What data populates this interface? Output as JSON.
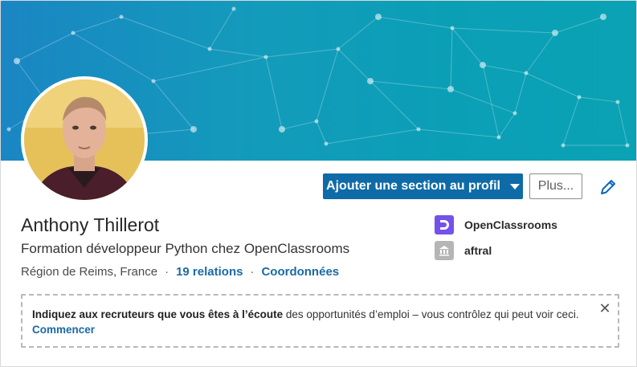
{
  "profile": {
    "name": "Anthony Thillerot",
    "headline": "Formation développeur Python chez OpenClassrooms",
    "location": "Région de Reims, France",
    "separator": "·",
    "relations_link": "19 relations",
    "contact_link": "Coordonnées"
  },
  "actions": {
    "add_section_label": "Ajouter une section au profil",
    "more_label": "Plus...",
    "edit_icon": "pencil-icon"
  },
  "organizations": [
    {
      "name": "OpenClassrooms",
      "logo": "openclassrooms-logo",
      "color": "#7451eb"
    },
    {
      "name": "aftral",
      "logo": "building-icon",
      "color": "#b5b5b5"
    }
  ],
  "notice": {
    "bold_text": "Indiquez aux recruteurs que vous êtes à l’écoute",
    "text": " des opportunités d’emploi – vous contrôlez qui peut voir ceci.",
    "link": "Commencer",
    "close_icon": "close-icon"
  },
  "colors": {
    "primary": "#0e6ba8",
    "link": "#1a6aa6",
    "banner_start": "#1a86c3",
    "banner_end": "#0aa2b4"
  }
}
